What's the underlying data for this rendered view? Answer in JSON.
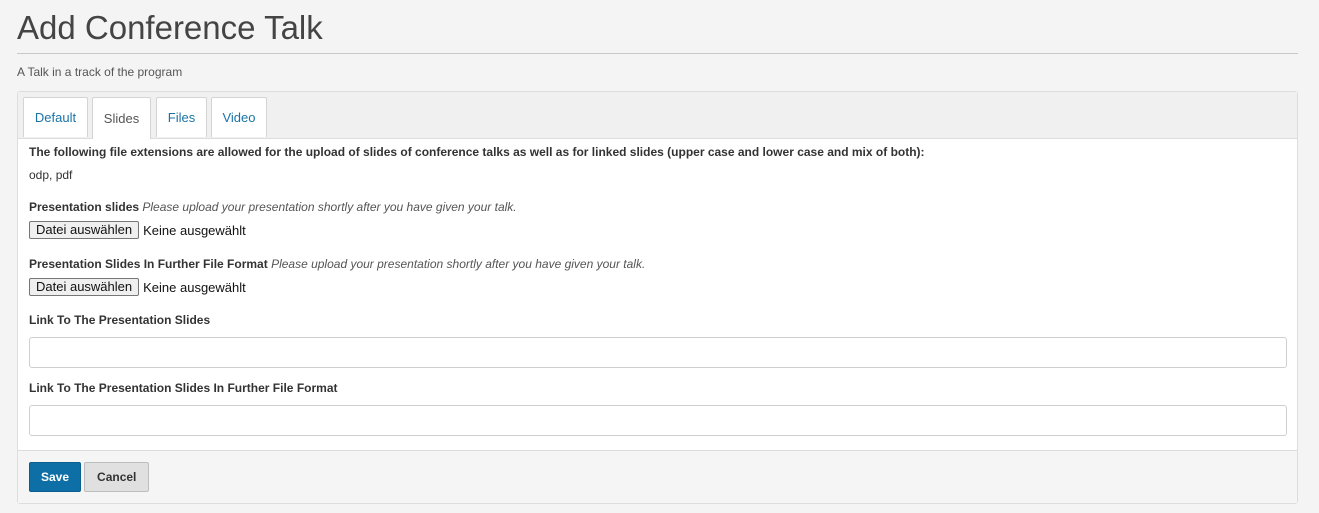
{
  "page": {
    "title": "Add Conference Talk",
    "description": "A Talk in a track of the program"
  },
  "tabs": [
    {
      "label": "Default",
      "active": false
    },
    {
      "label": "Slides",
      "active": true
    },
    {
      "label": "Files",
      "active": false
    },
    {
      "label": "Video",
      "active": false
    }
  ],
  "slides": {
    "info_text": "The following file extensions are allowed for the upload of slides of conference talks as well as for linked slides (upper case and lower case and mix of both):",
    "extensions": "odp, pdf",
    "presentation_slides": {
      "label": "Presentation slides",
      "description": "Please upload your presentation shortly after you have given your talk.",
      "button_label": "Datei auswählen",
      "status": "Keine ausgewählt"
    },
    "presentation_slides_further": {
      "label": "Presentation Slides In Further File Format",
      "description": "Please upload your presentation shortly after you have given your talk.",
      "button_label": "Datei auswählen",
      "status": "Keine ausgewählt"
    },
    "link_slides": {
      "label": "Link To The Presentation Slides",
      "value": ""
    },
    "link_slides_further": {
      "label": "Link To The Presentation Slides In Further File Format",
      "value": ""
    }
  },
  "actions": {
    "save_label": "Save",
    "cancel_label": "Cancel"
  },
  "colors": {
    "accent": "#0e6fa6",
    "tab_link": "#1a73a8"
  }
}
